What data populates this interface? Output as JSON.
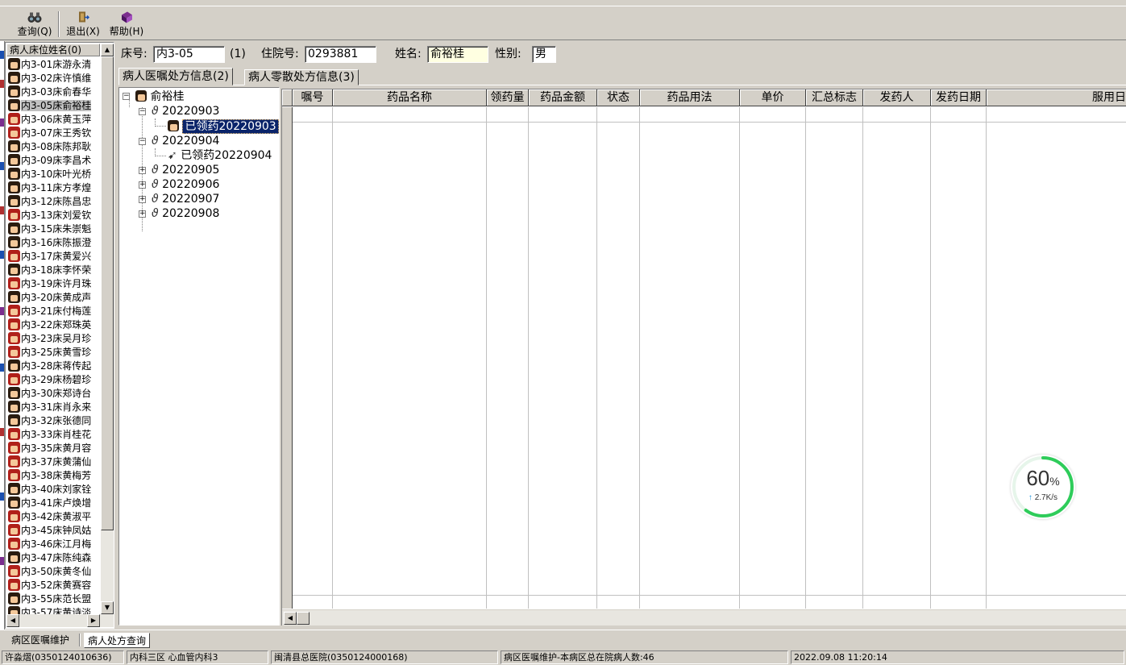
{
  "toolbar": {
    "query_label": "查询(Q)",
    "exit_label": "退出(X)",
    "help_label": "帮助(H)"
  },
  "patient_list": {
    "header": "病人床位姓名(0)",
    "items": [
      {
        "label": "内3-01床游永清",
        "g": "m"
      },
      {
        "label": "内3-02床许慎维",
        "g": "m"
      },
      {
        "label": "内3-03床俞春华",
        "g": "m"
      },
      {
        "label": "内3-05床俞裕桂",
        "g": "m"
      },
      {
        "label": "内3-06床黄玉萍",
        "g": "f"
      },
      {
        "label": "内3-07床王秀钦",
        "g": "f"
      },
      {
        "label": "内3-08床陈邦耿",
        "g": "m"
      },
      {
        "label": "内3-09床李昌术",
        "g": "m"
      },
      {
        "label": "内3-10床叶光桥",
        "g": "m"
      },
      {
        "label": "内3-11床方孝煌",
        "g": "m"
      },
      {
        "label": "内3-12床陈昌忠",
        "g": "m"
      },
      {
        "label": "内3-13床刘爱钦",
        "g": "f"
      },
      {
        "label": "内3-15床朱崇魁",
        "g": "m"
      },
      {
        "label": "内3-16床陈振澄",
        "g": "m"
      },
      {
        "label": "内3-17床黄爱兴",
        "g": "f"
      },
      {
        "label": "内3-18床李怀荣",
        "g": "m"
      },
      {
        "label": "内3-19床许月珠",
        "g": "f"
      },
      {
        "label": "内3-20床黄成声",
        "g": "m"
      },
      {
        "label": "内3-21床付梅莲",
        "g": "f"
      },
      {
        "label": "内3-22床郑珠英",
        "g": "f"
      },
      {
        "label": "内3-23床吴月珍",
        "g": "f"
      },
      {
        "label": "内3-25床黄雪珍",
        "g": "f"
      },
      {
        "label": "内3-28床蒋传起",
        "g": "m"
      },
      {
        "label": "内3-29床杨碧珍",
        "g": "f"
      },
      {
        "label": "内3-30床郑诗台",
        "g": "m"
      },
      {
        "label": "内3-31床肖永来",
        "g": "m"
      },
      {
        "label": "内3-32床张德同",
        "g": "m"
      },
      {
        "label": "内3-33床肖桂花",
        "g": "f"
      },
      {
        "label": "内3-35床黄月容",
        "g": "f"
      },
      {
        "label": "内3-37床黄蒲仙",
        "g": "f"
      },
      {
        "label": "内3-38床黄梅芳",
        "g": "f"
      },
      {
        "label": "内3-40床刘家铨",
        "g": "m"
      },
      {
        "label": "内3-41床卢焕增",
        "g": "m"
      },
      {
        "label": "内3-42床黄淑平",
        "g": "f"
      },
      {
        "label": "内3-45床钟凤姑",
        "g": "f"
      },
      {
        "label": "内3-46床江月梅",
        "g": "f"
      },
      {
        "label": "内3-47床陈纯森",
        "g": "m"
      },
      {
        "label": "内3-50床黄冬仙",
        "g": "f"
      },
      {
        "label": "内3-52床黄赛容",
        "g": "f"
      },
      {
        "label": "内3-55床范长盟",
        "g": "m"
      },
      {
        "label": "内3-57床黄诗淡",
        "g": "m"
      }
    ]
  },
  "patient_info": {
    "bed_label": "床号:",
    "bed_value": "内3-05",
    "bed_count": "(1)",
    "admission_label": "住院号:",
    "admission_value": "0293881",
    "name_label": "姓名:",
    "name_value": "俞裕桂",
    "sex_label": "性别:",
    "sex_value": "男"
  },
  "tabs": {
    "orders": "病人医嘱处方信息(2)",
    "misc": "病人零散处方信息(3)"
  },
  "tree": {
    "root": "俞裕桂",
    "n1": "20220903",
    "n1_child": "已领药20220903",
    "n2": "20220904",
    "n2_child": "已领药20220904",
    "n3": "20220905",
    "n4": "20220906",
    "n5": "20220907",
    "n6": "20220908"
  },
  "grid": {
    "columns": [
      "嘱号",
      "药品名称",
      "领药量",
      "药品金额",
      "状态",
      "药品用法",
      "单价",
      "汇总标志",
      "发药人",
      "发药日期",
      "服用日"
    ]
  },
  "bottom_tabs": {
    "ward_orders": "病区医嘱维护",
    "patient_rx": "病人处方查询"
  },
  "status": {
    "user": "许淼熠(0350124010636)",
    "dept": "内科三区 心血管内科3",
    "hospital": "闽清县总医院(0350124000168)",
    "info": "病区医嘱维护-本病区总在院病人数:46",
    "datetime": "2022.09.08 11:20:14"
  },
  "speed_widget": {
    "percent": "60",
    "percent_unit": "%",
    "rate": "2.7K/s",
    "ring_level": 0.6,
    "accent": "#2ecc5a"
  }
}
